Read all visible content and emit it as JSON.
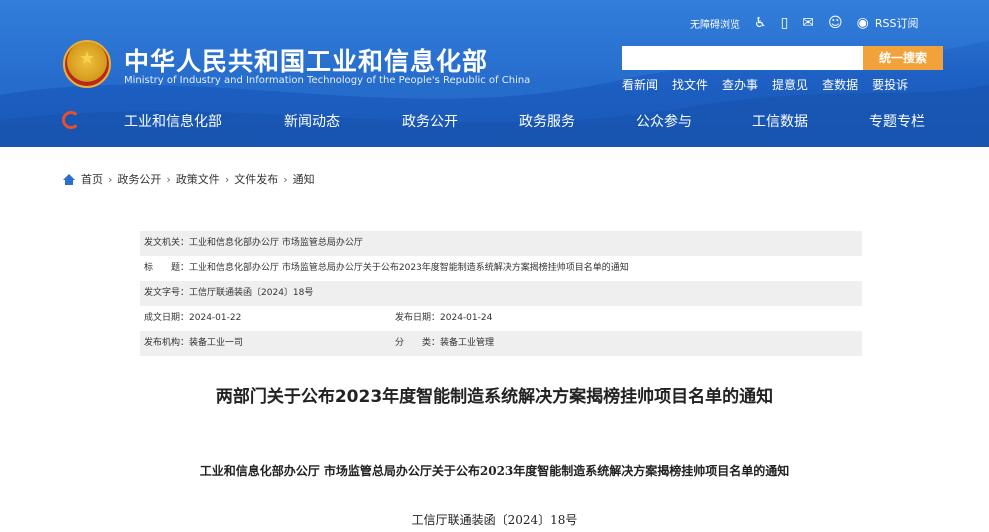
{
  "header": {
    "site_title": "中华人民共和国工业和信息化部",
    "site_subtitle": "Ministry of Industry and Information Technology of the People's Republic of China",
    "top_links": {
      "accessibility": "无障碍浏览",
      "rss": "RSS订阅"
    },
    "search": {
      "placeholder": "",
      "button": "统一搜索"
    },
    "quick_links": [
      "看新闻",
      "找文件",
      "查办事",
      "提意见",
      "查数据",
      "要投诉"
    ]
  },
  "nav": {
    "items": [
      "工业和信息化部",
      "新闻动态",
      "政务公开",
      "政务服务",
      "公众参与",
      "工信数据",
      "专题专栏"
    ]
  },
  "breadcrumb": [
    "首页",
    "政务公开",
    "政策文件",
    "文件发布",
    "通知"
  ],
  "meta": {
    "issuer_label": "发文机关：",
    "issuer": "工业和信息化部办公厅 市场监管总局办公厅",
    "title_label": "标　　题：",
    "title": "工业和信息化部办公厅 市场监管总局办公厅关于公布2023年度智能制造系统解决方案揭榜挂帅项目名单的通知",
    "docno_label": "发文字号：",
    "docno": "工信厅联通装函〔2024〕18号",
    "created_label": "成文日期：",
    "created": "2024-01-22",
    "published_label": "发布日期：",
    "published": "2024-01-24",
    "org_label": "发布机构：",
    "org": "装备工业一司",
    "category_label": "分　　类：",
    "category": "装备工业管理"
  },
  "article": {
    "title": "两部门关于公布2023年度智能制造系统解决方案揭榜挂帅项目名单的通知",
    "subtitle": "工业和信息化部办公厅  市场监管总局办公厅关于公布2023年度智能制造系统解决方案揭榜挂帅项目名单的通知",
    "doc_number": "工信厅联通装函〔2024〕18号"
  }
}
